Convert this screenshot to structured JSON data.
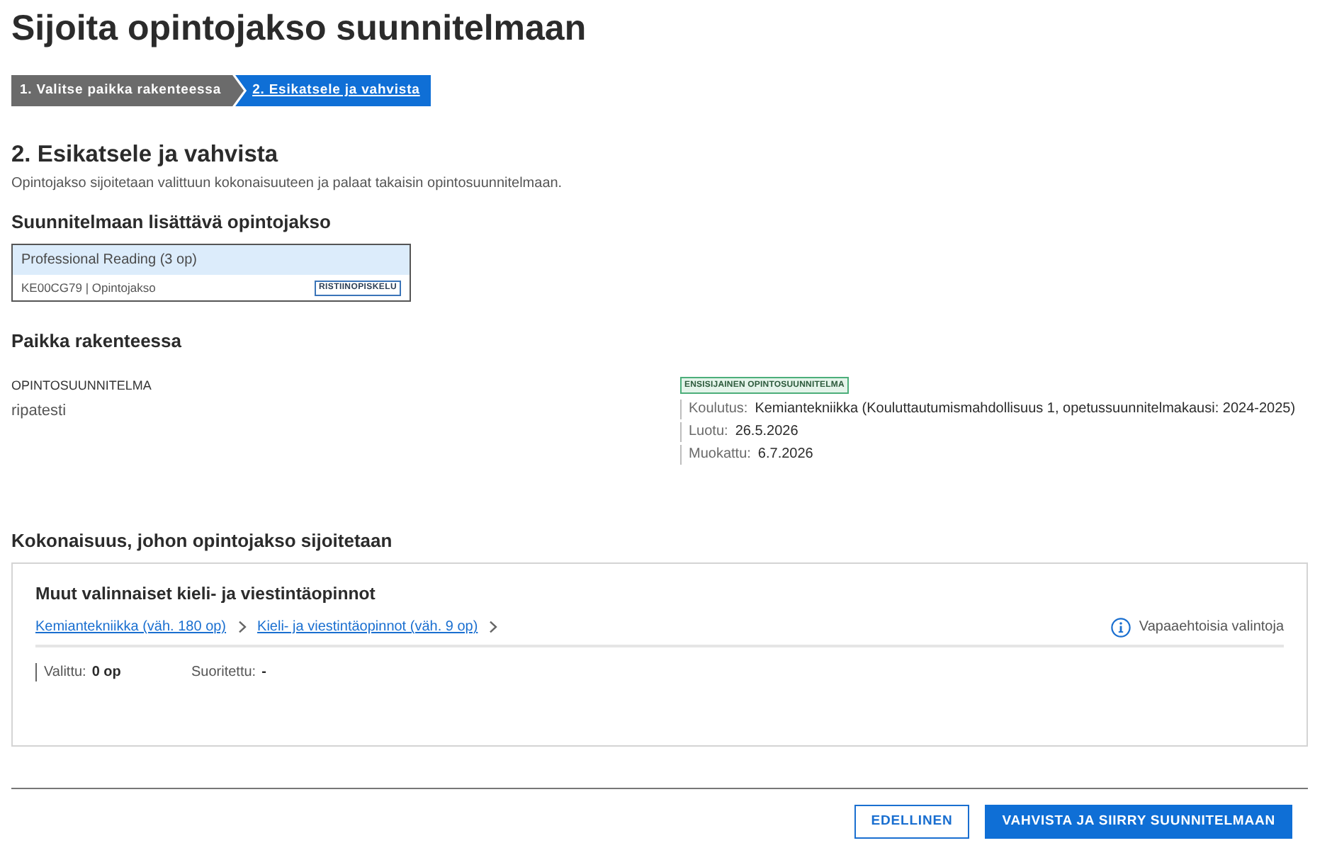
{
  "page": {
    "title": "Sijoita opintojakso suunnitelmaan"
  },
  "steps": [
    {
      "label": "1. Valitse paikka rakenteessa",
      "selected": false
    },
    {
      "label": "2. Esikatsele ja vahvista",
      "selected": true
    }
  ],
  "section": {
    "heading": "2. Esikatsele ja vahvista",
    "description": "Opintojakso sijoitetaan valittuun kokonaisuuteen ja palaat takaisin opintosuunnitelmaan."
  },
  "course_section": {
    "heading": "Suunnitelmaan lisättävä opintojakso",
    "course": {
      "name": "Professional Reading (3 op)",
      "meta": "KE00CG79 | Opintojakso",
      "badge": "RISTIINOPISKELU"
    }
  },
  "placement": {
    "heading": "Paikka rakenteessa",
    "plan_label": "OPINTOSUUNNITELMA",
    "plan_name": "ripatesti",
    "badge": "ENSISIJAINEN OPINTOSUUNNITELMA",
    "details": [
      {
        "label": "Koulutus:",
        "value": "Kemiantekniikka (Kouluttautumismahdollisuus 1, opetussuunnitelmakausi: 2024-2025)"
      },
      {
        "label": "Luotu:",
        "value": "26.5.2026"
      },
      {
        "label": "Muokattu:",
        "value": "6.7.2026"
      }
    ]
  },
  "target": {
    "heading": "Kokonaisuus, johon opintojakso sijoitetaan",
    "title": "Muut valinnaiset kieli- ja viestintäopinnot",
    "breadcrumb": [
      "Kemiantekniikka (väh. 180 op)",
      "Kieli- ja viestintäopinnot (väh. 9 op)"
    ],
    "note": "Vapaaehtoisia valintoja",
    "stats": [
      {
        "label": "Valittu:",
        "value": "0 op"
      },
      {
        "label": "Suoritettu:",
        "value": "-"
      }
    ]
  },
  "buttons": [
    {
      "label": "EDELLINEN",
      "kind": "secondary"
    },
    {
      "label": "VAHVISTA JA SIIRRY SUUNNITELMAAN",
      "kind": "primary"
    }
  ]
}
